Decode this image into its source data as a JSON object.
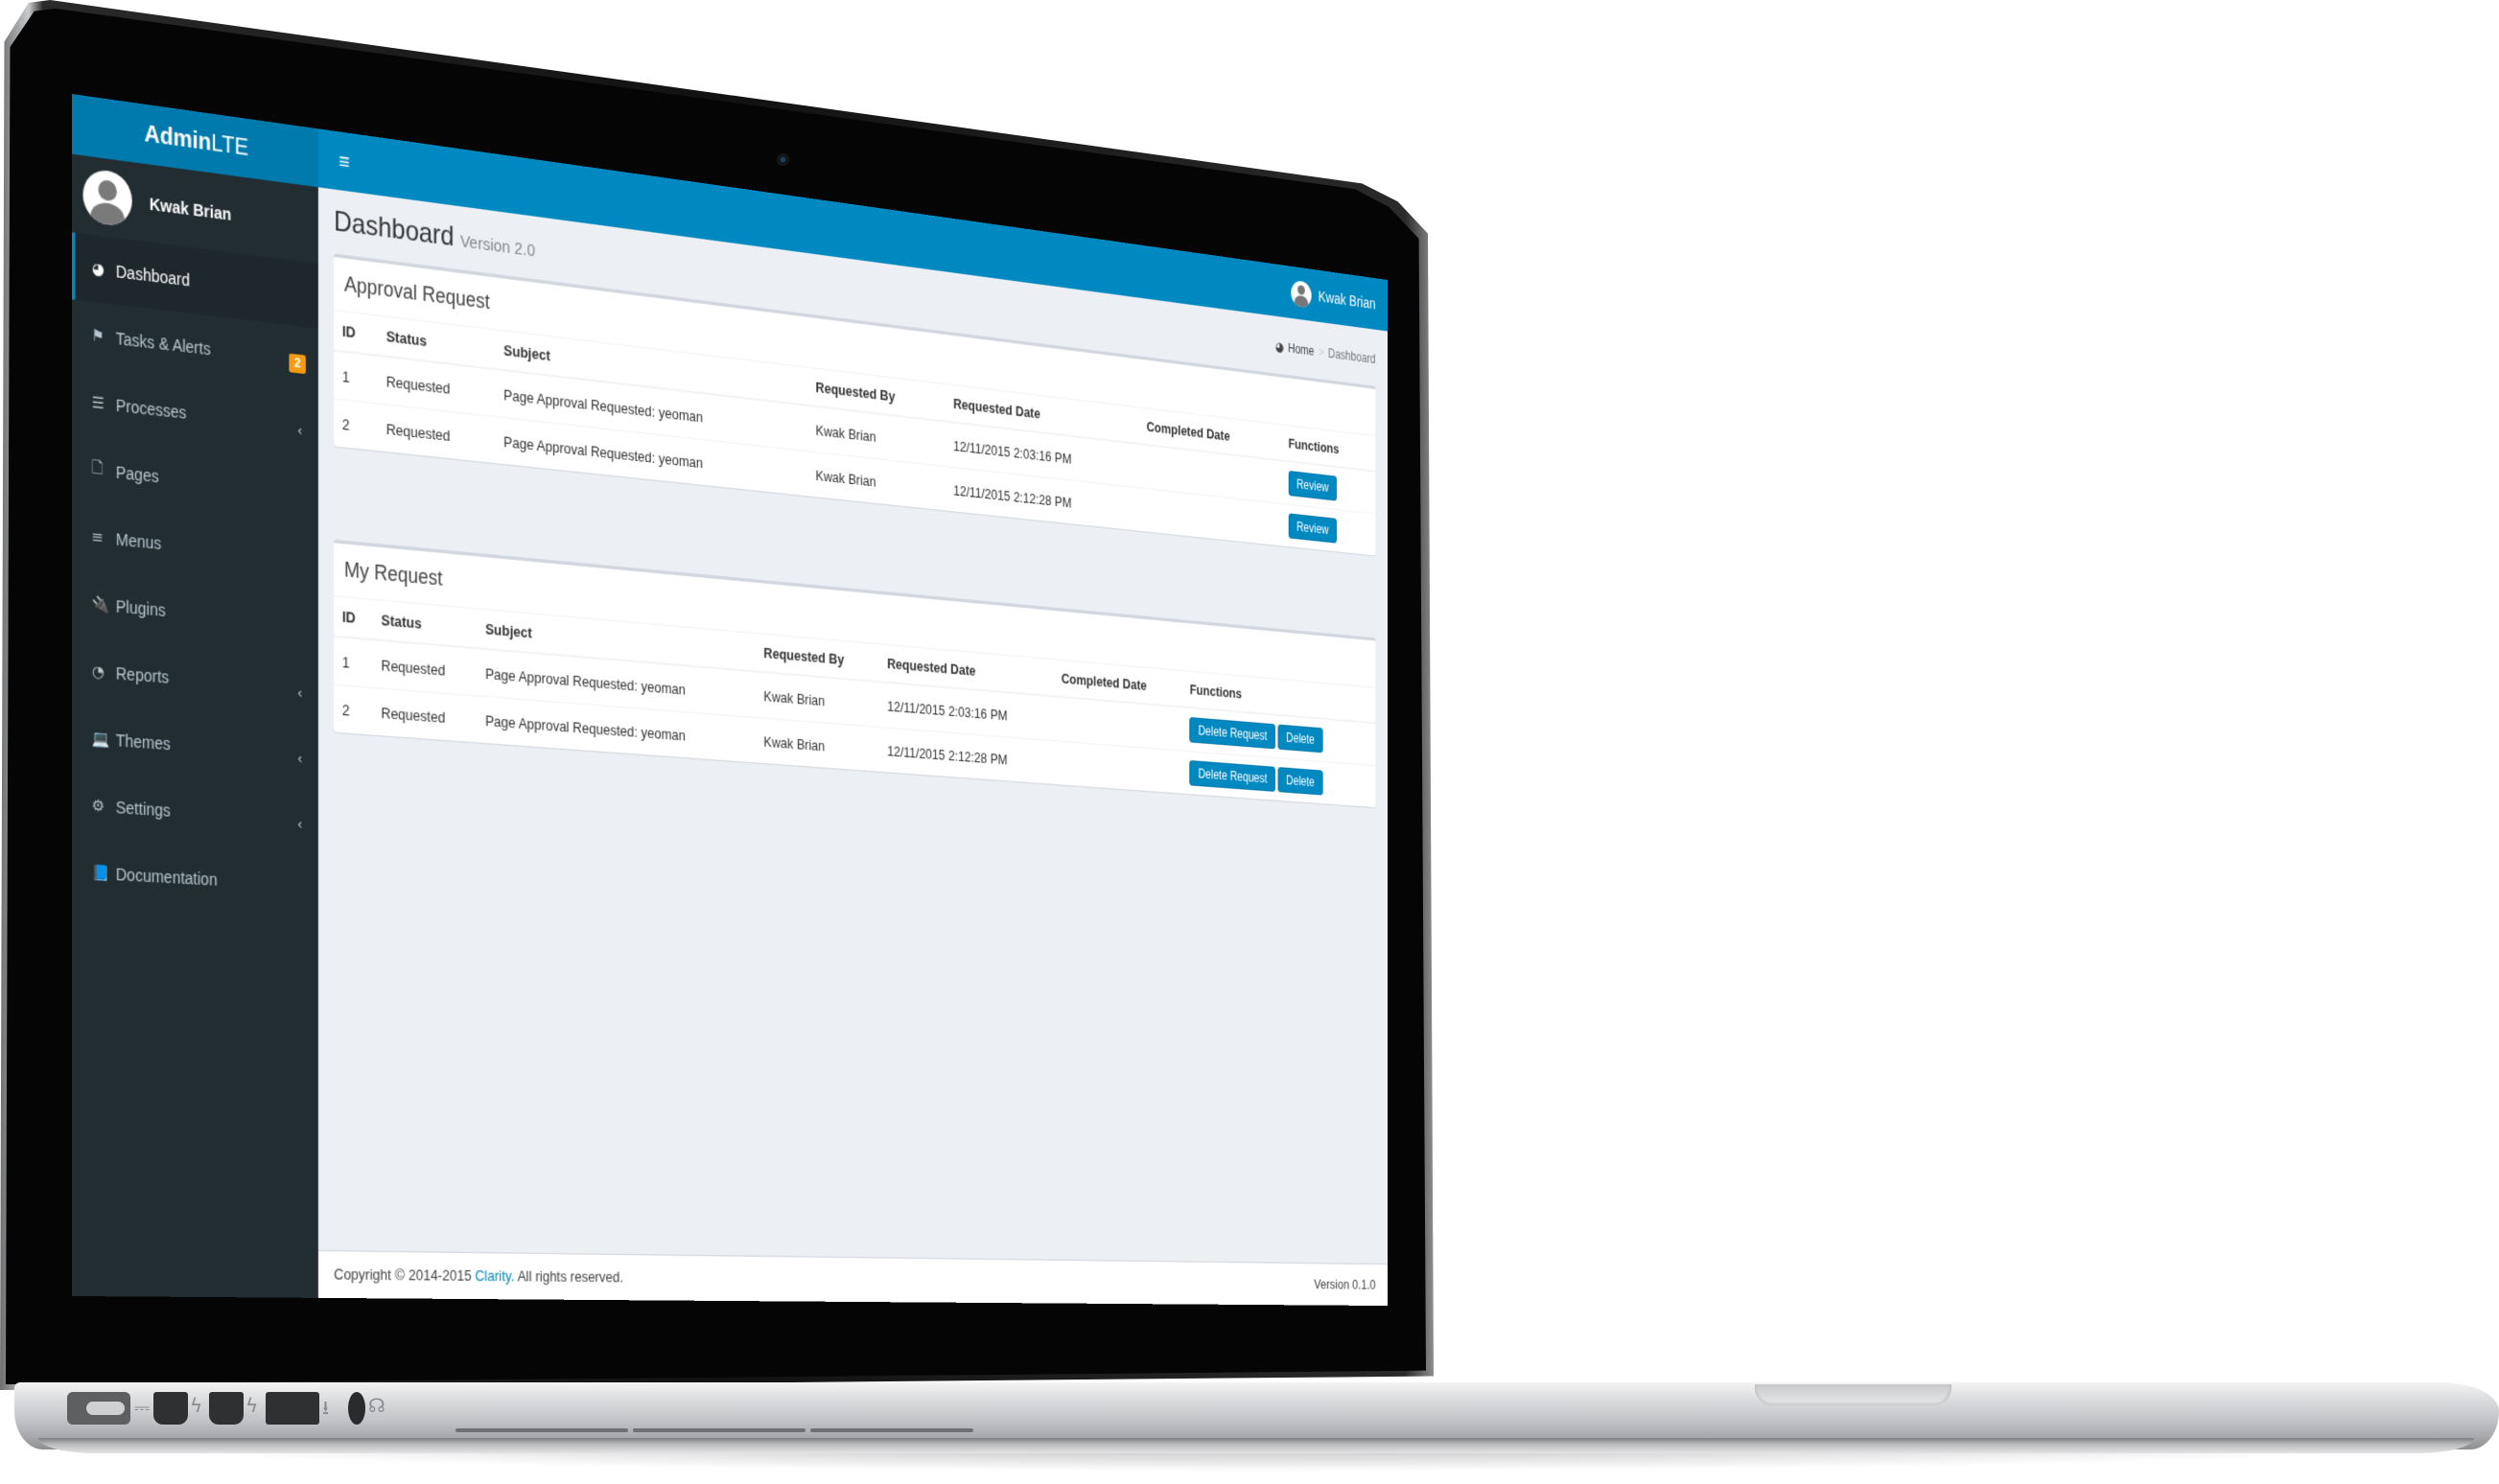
{
  "app": {
    "logo_bold": "Admin",
    "logo_light": "LTE",
    "user_name": "Kwak Brian"
  },
  "header": {
    "toggle_icon": "hamburger-menu-icon",
    "user_name": "Kwak Brian"
  },
  "sidebar": {
    "user_name": "Kwak Brian",
    "items": [
      {
        "label": "Dashboard",
        "icon": "dashboard-icon",
        "glyph": "◕",
        "active": true
      },
      {
        "label": "Tasks & Alerts",
        "icon": "flag-icon",
        "glyph": "⚑",
        "badge": "2"
      },
      {
        "label": "Processes",
        "icon": "server-icon",
        "glyph": "☰",
        "chevron": "‹"
      },
      {
        "label": "Pages",
        "icon": "file-icon",
        "glyph": "🗋"
      },
      {
        "label": "Menus",
        "icon": "bars-icon",
        "glyph": "≡"
      },
      {
        "label": "Plugins",
        "icon": "plug-icon",
        "glyph": "🔌"
      },
      {
        "label": "Reports",
        "icon": "pie-chart-icon",
        "glyph": "◔",
        "chevron": "‹"
      },
      {
        "label": "Themes",
        "icon": "laptop-icon",
        "glyph": "💻",
        "chevron": "‹"
      },
      {
        "label": "Settings",
        "icon": "gear-icon",
        "glyph": "⚙",
        "chevron": "‹"
      },
      {
        "label": "Documentation",
        "icon": "book-icon",
        "glyph": "📘"
      }
    ]
  },
  "content": {
    "title": "Dashboard",
    "subtitle": "Version 2.0",
    "breadcrumb": {
      "home_icon": "dashboard-icon",
      "home": "Home",
      "separator": ">",
      "current": "Dashboard"
    }
  },
  "approval": {
    "title": "Approval Request",
    "columns": [
      "ID",
      "Status",
      "Subject",
      "Requested By",
      "Requested Date",
      "Completed Date",
      "Functions"
    ],
    "rows": [
      {
        "id": "1",
        "status": "Requested",
        "subject": "Page Approval Requested: yeoman",
        "requested_by": "Kwak Brian",
        "requested_date": "12/11/2015 2:03:16 PM",
        "completed_date": "",
        "buttons": [
          "Review"
        ]
      },
      {
        "id": "2",
        "status": "Requested",
        "subject": "Page Approval Requested: yeoman",
        "requested_by": "Kwak Brian",
        "requested_date": "12/11/2015 2:12:28 PM",
        "completed_date": "",
        "buttons": [
          "Review"
        ]
      }
    ]
  },
  "myrequest": {
    "title": "My Request",
    "columns": [
      "ID",
      "Status",
      "Subject",
      "Requested By",
      "Requested Date",
      "Completed Date",
      "Functions"
    ],
    "rows": [
      {
        "id": "1",
        "status": "Requested",
        "subject": "Page Approval Requested: yeoman",
        "requested_by": "Kwak Brian",
        "requested_date": "12/11/2015 2:03:16 PM",
        "completed_date": "",
        "buttons": [
          "Delete Request",
          "Delete"
        ]
      },
      {
        "id": "2",
        "status": "Requested",
        "subject": "Page Approval Requested: yeoman",
        "requested_by": "Kwak Brian",
        "requested_date": "12/11/2015 2:12:28 PM",
        "completed_date": "",
        "buttons": [
          "Delete Request",
          "Delete"
        ]
      }
    ]
  },
  "footer": {
    "copyright_prefix": "Copyright © 2014-2015",
    "brand": "Clarity.",
    "copyright_suffix": "All rights reserved.",
    "version": "Version 0.1.0"
  },
  "colors": {
    "brand_blue": "#0088c1",
    "logo_blue": "#0079ad",
    "sidebar_bg": "#222d32",
    "badge_orange": "#f39c12",
    "content_bg": "#ecf0f5"
  },
  "hardware": {
    "ports": [
      "magsafe-port",
      "thunderbolt-port",
      "thunderbolt-port",
      "usb-port",
      "headphone-port"
    ]
  }
}
